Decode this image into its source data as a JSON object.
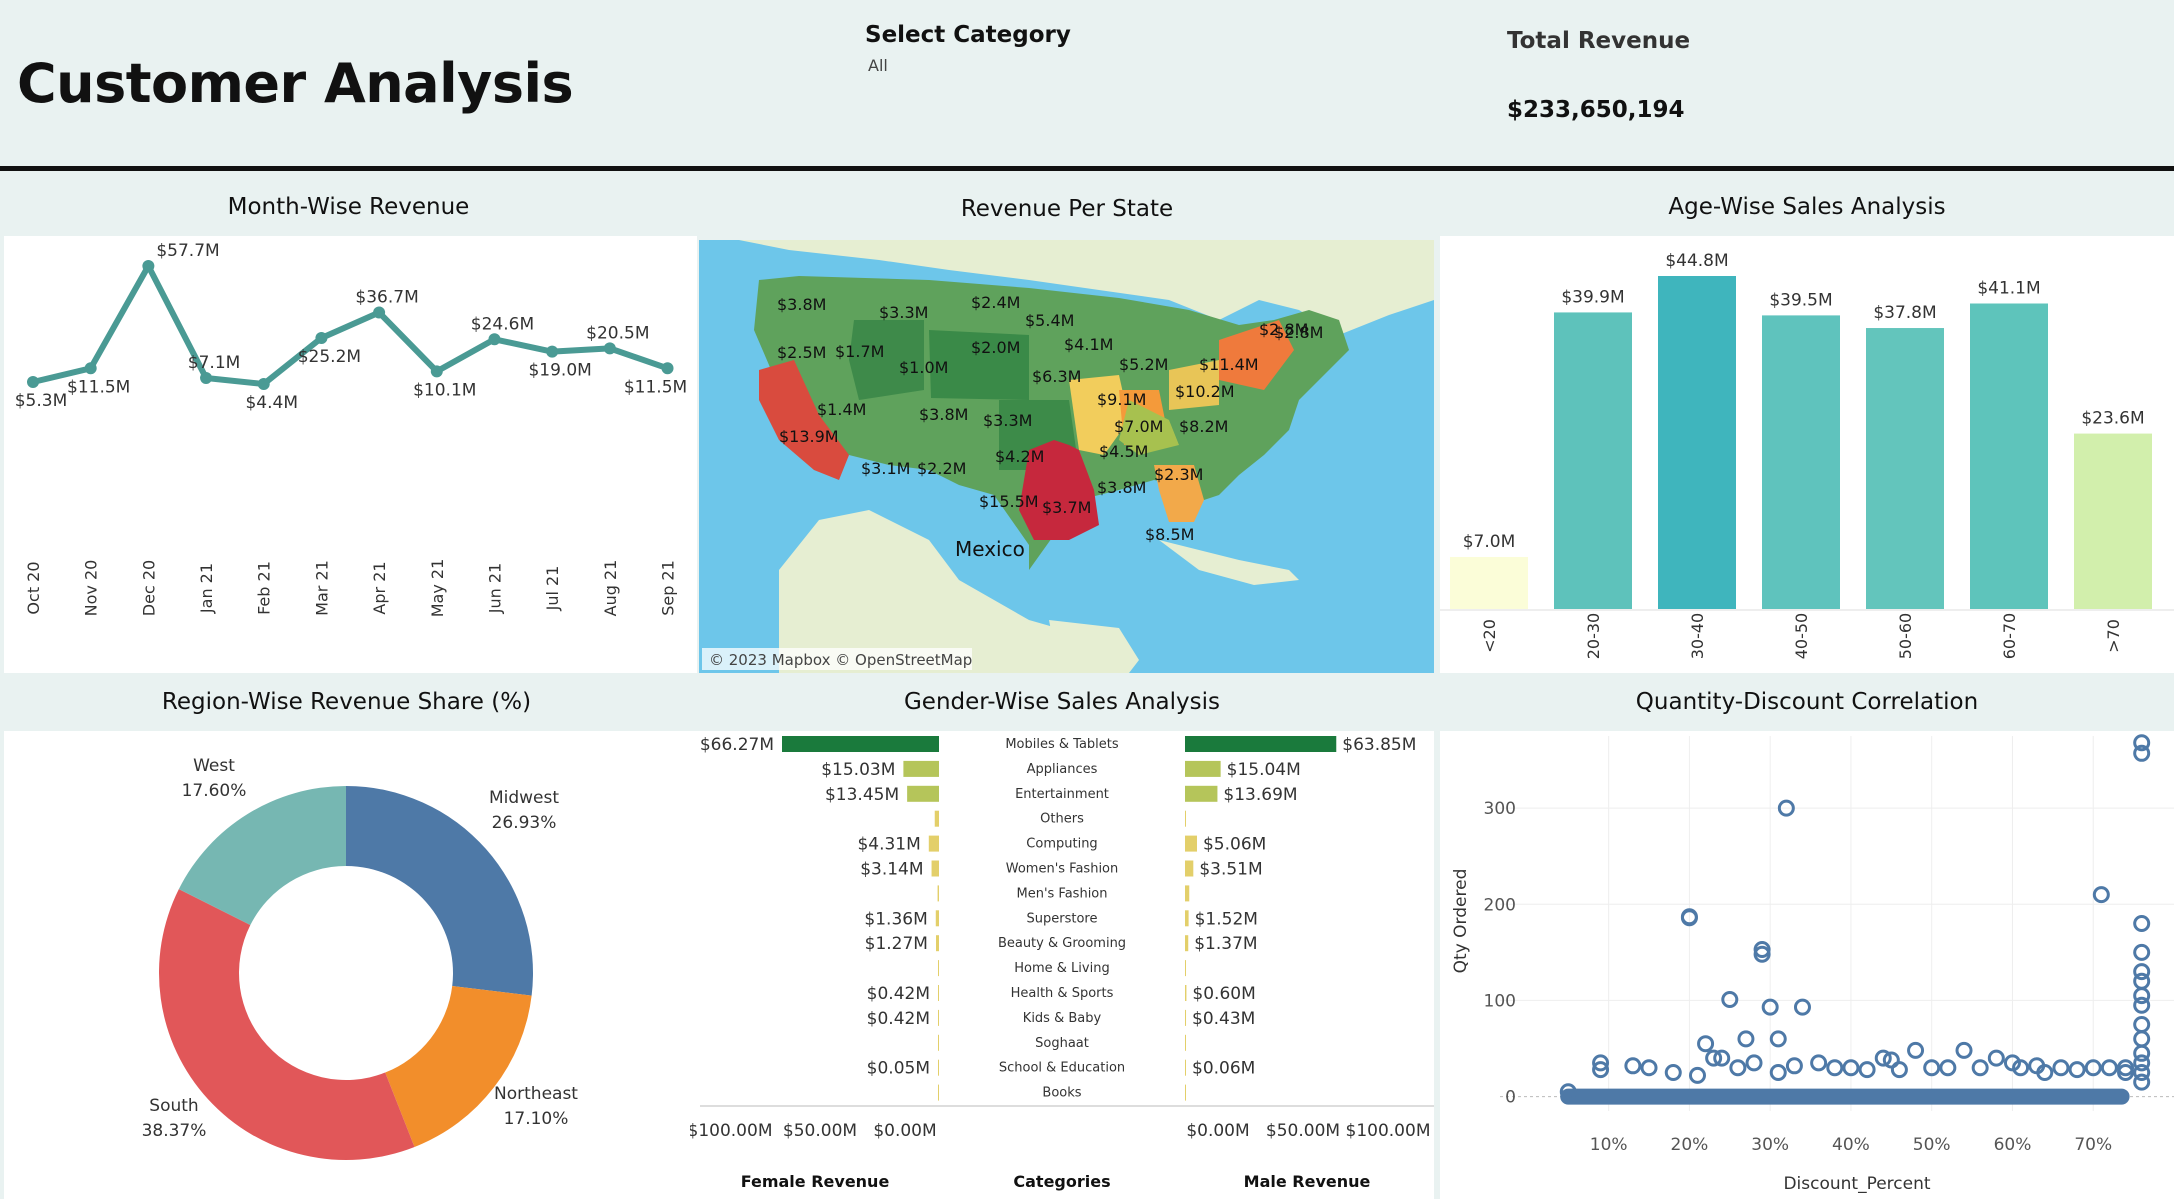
{
  "header": {
    "title": "Customer Analysis",
    "select_label": "Select Category",
    "select_value": "All",
    "revenue_label": "Total Revenue",
    "revenue_value": "$233,650,194"
  },
  "panels": {
    "month": "Month-Wise Revenue",
    "state": "Revenue Per State",
    "age": "Age-Wise Sales Analysis",
    "region": "Region-Wise Revenue Share (%)",
    "gender": "Gender-Wise Sales Analysis",
    "qty": "Quantity-Discount Correlation"
  },
  "colors": {
    "line": "#4a9a94",
    "female_top": "#1a7a3c",
    "male_top": "#1a7a3c",
    "scatter": "#4e79a7"
  },
  "chart_data": [
    {
      "type": "line",
      "title": "Month-Wise Revenue",
      "categories": [
        "Oct 20",
        "Nov 20",
        "Dec 20",
        "Jan 21",
        "Feb 21",
        "Mar 21",
        "Apr 21",
        "May 21",
        "Jun 21",
        "Jul 21",
        "Aug 21",
        "Sep 21"
      ],
      "values": [
        5.3,
        11.5,
        57.7,
        7.1,
        4.4,
        25.2,
        36.7,
        10.1,
        24.6,
        19.0,
        20.5,
        11.5
      ],
      "labels": [
        "$5.3M",
        "$11.5M",
        "$57.7M",
        "$7.1M",
        "$4.4M",
        "$25.2M",
        "$36.7M",
        "$10.1M",
        "$24.6M",
        "$19.0M",
        "$20.5M",
        "$11.5M"
      ]
    },
    {
      "type": "bar",
      "title": "Age-Wise Sales Analysis",
      "categories": [
        "<20",
        "20-30",
        "30-40",
        "40-50",
        "50-60",
        "60-70",
        ">70"
      ],
      "values": [
        7.0,
        39.9,
        44.8,
        39.5,
        37.8,
        41.1,
        23.6
      ],
      "labels": [
        "$7.0M",
        "$39.9M",
        "$44.8M",
        "$39.5M",
        "$37.8M",
        "$41.1M",
        "$23.6M"
      ],
      "colors": [
        "#fbfdd8",
        "#5ec2bb",
        "#3fb5bd",
        "#5fc3bd",
        "#63c5bc",
        "#5ec4bb",
        "#d2efac"
      ]
    },
    {
      "type": "pie",
      "title": "Region-Wise Revenue Share (%)",
      "categories": [
        "Midwest",
        "Northeast",
        "South",
        "West"
      ],
      "values": [
        26.93,
        17.1,
        38.37,
        17.6
      ],
      "labels": [
        "26.93%",
        "17.10%",
        "38.37%",
        "17.60%"
      ],
      "colors": [
        "#4e79a7",
        "#f28e2b",
        "#e15759",
        "#76b7b2"
      ]
    },
    {
      "type": "bar",
      "title": "Gender-Wise Sales Analysis",
      "categories": [
        "Mobiles & Tablets",
        "Appliances",
        "Entertainment",
        "Others",
        "Computing",
        "Women's Fashion",
        "Men's Fashion",
        "Superstore",
        "Beauty & Grooming",
        "Home & Living",
        "Health & Sports",
        "Kids & Baby",
        "Soghaat",
        "School & Education",
        "Books"
      ],
      "series": [
        {
          "name": "Female Revenue",
          "values": [
            66.27,
            15.03,
            13.45,
            1.8,
            4.31,
            3.14,
            0.6,
            1.36,
            1.27,
            0.2,
            0.42,
            0.42,
            0.05,
            0.05,
            0.02
          ],
          "labels": [
            "$66.27M",
            "$15.03M",
            "$13.45M",
            "",
            "$4.31M",
            "$3.14M",
            "",
            "$1.36M",
            "$1.27M",
            "",
            "$0.42M",
            "$0.42M",
            "",
            "$0.05M",
            ""
          ]
        },
        {
          "name": "Male Revenue",
          "values": [
            63.85,
            15.04,
            13.69,
            0.2,
            5.06,
            3.51,
            1.8,
            1.52,
            1.37,
            0.2,
            0.6,
            0.43,
            0.05,
            0.06,
            0.02
          ],
          "labels": [
            "$63.85M",
            "$15.04M",
            "$13.69M",
            "",
            "$5.06M",
            "$3.51M",
            "",
            "$1.52M",
            "$1.37M",
            "",
            "$0.60M",
            "$0.43M",
            "",
            "$0.06M",
            ""
          ]
        }
      ],
      "axis_ticks": [
        "$100.00M",
        "$50.00M",
        "$0.00M"
      ],
      "axis_ticks_male": [
        "$0.00M",
        "$50.00M",
        "$100.00M"
      ],
      "xlabel_left": "Female Revenue",
      "xlabel_center": "Categories",
      "xlabel_right": "Male Revenue"
    },
    {
      "type": "scatter",
      "title": "Quantity-Discount Correlation",
      "xlabel": "Discount_Percent",
      "ylabel": "Qty Ordered",
      "xticks": [
        "10%",
        "20%",
        "30%",
        "40%",
        "50%",
        "60%",
        "70%"
      ],
      "yticks": [
        "0",
        "100",
        "200",
        "300"
      ],
      "xlim": [
        0.015,
        0.8
      ],
      "ylim": [
        -15,
        375
      ],
      "points": [
        [
          0.32,
          300
        ],
        [
          0.2,
          187
        ],
        [
          0.2,
          186
        ],
        [
          0.29,
          153
        ],
        [
          0.29,
          148
        ],
        [
          0.25,
          101
        ],
        [
          0.3,
          93
        ],
        [
          0.34,
          93
        ],
        [
          0.27,
          60
        ],
        [
          0.31,
          60
        ],
        [
          0.22,
          55
        ],
        [
          0.23,
          40
        ],
        [
          0.24,
          40
        ],
        [
          0.28,
          35
        ],
        [
          0.09,
          35
        ],
        [
          0.09,
          28
        ],
        [
          0.13,
          32
        ],
        [
          0.15,
          30
        ],
        [
          0.33,
          32
        ],
        [
          0.31,
          25
        ],
        [
          0.38,
          30
        ],
        [
          0.42,
          28
        ],
        [
          0.44,
          40
        ],
        [
          0.45,
          38
        ],
        [
          0.48,
          48
        ],
        [
          0.54,
          48
        ],
        [
          0.56,
          30
        ],
        [
          0.58,
          40
        ],
        [
          0.66,
          30
        ],
        [
          0.74,
          25
        ],
        [
          0.74,
          30
        ],
        [
          0.52,
          30
        ],
        [
          0.61,
          30
        ],
        [
          0.7,
          30
        ],
        [
          0.68,
          28
        ],
        [
          0.64,
          25
        ],
        [
          0.76,
          368
        ],
        [
          0.76,
          357
        ],
        [
          0.71,
          210
        ],
        [
          0.76,
          180
        ],
        [
          0.76,
          150
        ],
        [
          0.76,
          130
        ],
        [
          0.76,
          120
        ],
        [
          0.76,
          105
        ],
        [
          0.76,
          95
        ],
        [
          0.76,
          75
        ],
        [
          0.76,
          60
        ],
        [
          0.76,
          45
        ],
        [
          0.76,
          35
        ],
        [
          0.76,
          25
        ],
        [
          0.76,
          15
        ],
        [
          0.36,
          35
        ],
        [
          0.4,
          30
        ],
        [
          0.46,
          28
        ],
        [
          0.5,
          30
        ],
        [
          0.6,
          35
        ],
        [
          0.63,
          32
        ],
        [
          0.72,
          30
        ],
        [
          0.18,
          25
        ],
        [
          0.21,
          22
        ],
        [
          0.26,
          30
        ],
        [
          0.05,
          5
        ]
      ]
    },
    {
      "type": "map",
      "title": "Revenue Per State",
      "labels": [
        "$3.8M",
        "$3.3M",
        "$2.4M",
        "$5.4M",
        "$2.8M",
        "$2.5M",
        "$1.7M",
        "$2.0M",
        "$4.1M",
        "$1.0M",
        "$6.3M",
        "$5.2M",
        "$11.4M",
        "$2.8M",
        "$1.4M",
        "$3.8M",
        "$9.1M",
        "$10.2M",
        "$13.9M",
        "$3.3M",
        "$7.0M",
        "$8.2M",
        "$4.2M",
        "$4.5M",
        "$3.1M",
        "$2.2M",
        "$2.3M",
        "$3.8M",
        "$15.5M",
        "$3.7M",
        "$8.5M"
      ],
      "place": "Mexico",
      "attribution": "© 2023 Mapbox © OpenStreetMap"
    }
  ]
}
